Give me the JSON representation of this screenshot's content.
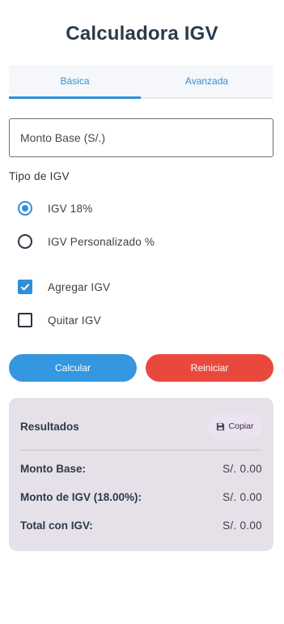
{
  "app": {
    "title": "Calculadora IGV"
  },
  "tabs": [
    {
      "label": "Básica",
      "active": true
    },
    {
      "label": "Avanzada",
      "active": false
    }
  ],
  "amount_input": {
    "placeholder": "Monto Base (S/.)",
    "value": ""
  },
  "igv_type": {
    "label": "Tipo de IGV",
    "options": [
      {
        "label": "IGV 18%",
        "selected": true
      },
      {
        "label": "IGV Personalizado %",
        "selected": false
      }
    ]
  },
  "actions": {
    "options": [
      {
        "label": "Agregar IGV",
        "checked": true
      },
      {
        "label": "Quitar IGV",
        "checked": false
      }
    ]
  },
  "buttons": {
    "calculate": "Calcular",
    "reset": "Reiniciar"
  },
  "results": {
    "title": "Resultados",
    "copy_label": "Copiar",
    "rows": [
      {
        "label": "Monto Base:",
        "value": "S/. 0.00"
      },
      {
        "label": "Monto de IGV (18.00%):",
        "value": "S/. 0.00"
      },
      {
        "label": "Total con IGV:",
        "value": "S/. 0.00"
      }
    ]
  },
  "colors": {
    "primary": "#3497df",
    "danger": "#e9493d",
    "results_bg": "#e6e0e9"
  },
  "icons": {
    "copy": "save-icon",
    "checkbox_checked": "check-icon"
  }
}
